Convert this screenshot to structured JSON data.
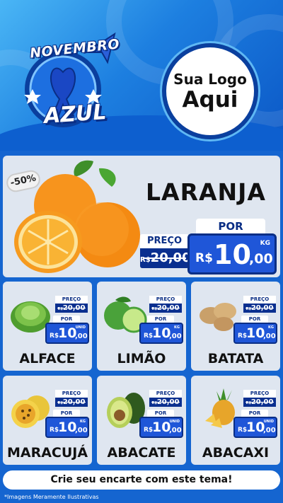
{
  "campaign": {
    "badge_line1": "NOVEMBRO",
    "badge_line2": "AZUL"
  },
  "logo": {
    "line1": "Sua Logo",
    "line2": "Aqui"
  },
  "featured": {
    "discount": "-50%",
    "name": "LARANJA",
    "old_label": "PREÇO",
    "old_currency": "R$",
    "old_price": "20,00",
    "new_label": "POR",
    "currency": "R$",
    "price_int": "10",
    "price_dec": ",00",
    "unit": "KG"
  },
  "products": [
    {
      "name": "ALFACE",
      "old_label": "PREÇO",
      "old_currency": "R$",
      "old_price": "20,00",
      "new_label": "POR",
      "currency": "R$",
      "price_int": "10",
      "price_dec": ",00",
      "unit": "UNID",
      "icon": "lettuce-icon"
    },
    {
      "name": "LIMÃO",
      "old_label": "PREÇO",
      "old_currency": "R$",
      "old_price": "20,00",
      "new_label": "POR",
      "currency": "R$",
      "price_int": "10",
      "price_dec": ",00",
      "unit": "KG",
      "icon": "lime-icon"
    },
    {
      "name": "BATATA",
      "old_label": "PREÇO",
      "old_currency": "R$",
      "old_price": "20,00",
      "new_label": "POR",
      "currency": "R$",
      "price_int": "10",
      "price_dec": ",00",
      "unit": "KG",
      "icon": "potato-icon"
    },
    {
      "name": "MARACUJÁ",
      "old_label": "PREÇO",
      "old_currency": "R$",
      "old_price": "20,00",
      "new_label": "POR",
      "currency": "R$",
      "price_int": "10",
      "price_dec": ",00",
      "unit": "KG",
      "icon": "passionfruit-icon"
    },
    {
      "name": "ABACATE",
      "old_label": "PREÇO",
      "old_currency": "R$",
      "old_price": "20,00",
      "new_label": "POR",
      "currency": "R$",
      "price_int": "10",
      "price_dec": ",00",
      "unit": "UNID",
      "icon": "avocado-icon"
    },
    {
      "name": "ABACAXI",
      "old_label": "PREÇO",
      "old_currency": "R$",
      "old_price": "20,00",
      "new_label": "POR",
      "currency": "R$",
      "price_int": "10",
      "price_dec": ",00",
      "unit": "UNID",
      "icon": "pineapple-icon"
    }
  ],
  "cta": "Crie seu encarte com este tema!",
  "disclaimer": "*Imagens Meramente Ilustrativas",
  "colors": {
    "primary_blue": "#1f56d8",
    "dark_blue": "#0a2f8f",
    "card_bg": "#dfe6f0"
  }
}
